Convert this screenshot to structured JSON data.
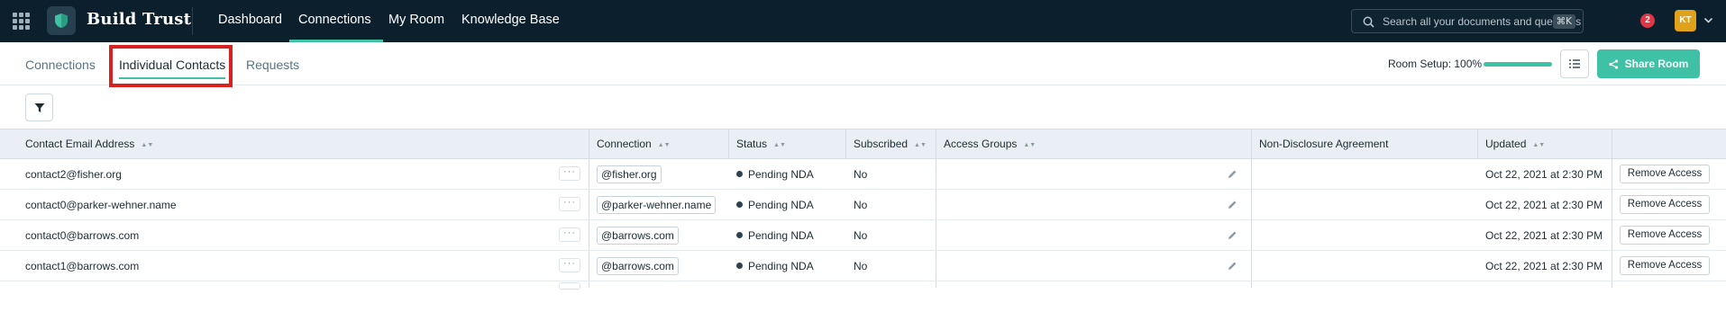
{
  "brand": {
    "name": "Build Trust"
  },
  "nav": {
    "links": [
      "Dashboard",
      "Connections",
      "My Room",
      "Knowledge Base"
    ],
    "active": "Connections"
  },
  "search": {
    "placeholder": "Search all your documents and questions",
    "shortcut": "⌘K"
  },
  "notifications": {
    "count": "2"
  },
  "user": {
    "initials": "KT"
  },
  "subtabs": [
    "Connections",
    "Individual Contacts",
    "Requests"
  ],
  "active_subtab": "Individual Contacts",
  "room_setup": {
    "label": "Room Setup: 100%",
    "progress": 1.0
  },
  "share_button": "Share Room",
  "table": {
    "columns": [
      "Contact Email Address",
      "Connection",
      "Status",
      "Subscribed",
      "Access Groups",
      "Non-Disclosure Agreement",
      "Updated"
    ],
    "rows": [
      {
        "email": "contact2@fisher.org",
        "connection": "@fisher.org",
        "status": "Pending NDA",
        "subscribed": "No",
        "updated": "Oct 22, 2021 at 2:30 PM",
        "action": "Remove Access"
      },
      {
        "email": "contact0@parker-wehner.name",
        "connection": "@parker-wehner.name",
        "status": "Pending NDA",
        "subscribed": "No",
        "updated": "Oct 22, 2021 at 2:30 PM",
        "action": "Remove Access"
      },
      {
        "email": "contact0@barrows.com",
        "connection": "@barrows.com",
        "status": "Pending NDA",
        "subscribed": "No",
        "updated": "Oct 22, 2021 at 2:30 PM",
        "action": "Remove Access"
      },
      {
        "email": "contact1@barrows.com",
        "connection": "@barrows.com",
        "status": "Pending NDA",
        "subscribed": "No",
        "updated": "Oct 22, 2021 at 2:30 PM",
        "action": "Remove Access"
      }
    ]
  },
  "colors": {
    "nav_bg": "#0c1f2c",
    "accent": "#3ec1a4",
    "highlight": "#d82121"
  },
  "icons": [
    "apps-grid-icon",
    "shield-logo-icon",
    "search-icon",
    "chevron-down-icon",
    "list-icon",
    "share-icon",
    "filter-icon",
    "more-dots-icon",
    "pencil-icon"
  ]
}
